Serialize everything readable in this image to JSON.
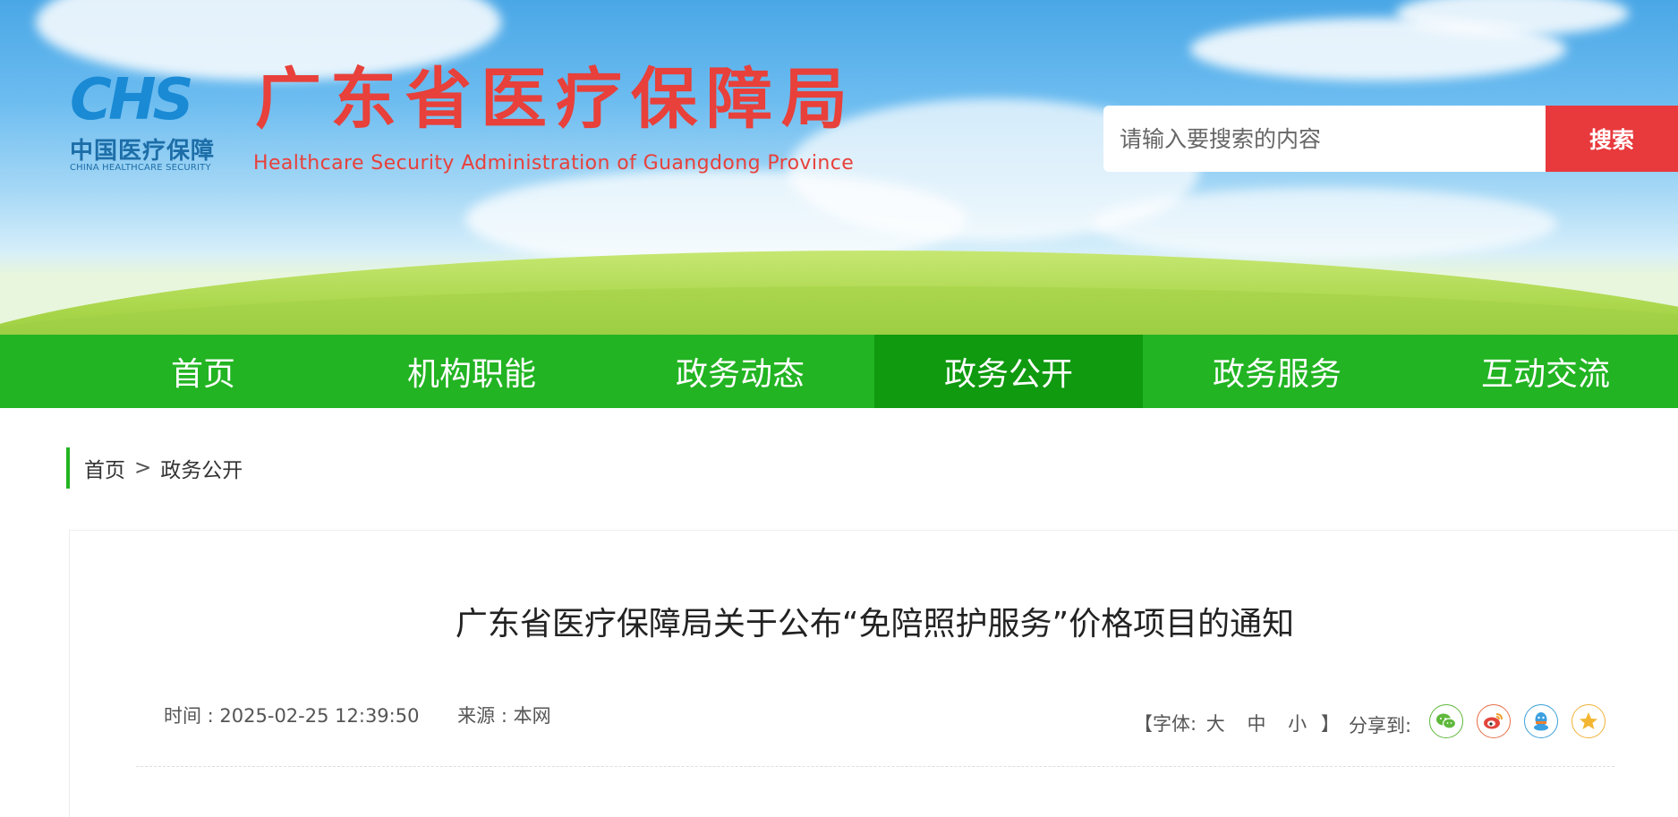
{
  "colors": {
    "nav_green": "#22b422",
    "nav_active": "#0f9a0f",
    "brand_red": "#e8403a",
    "search_red": "#e8393c",
    "logo_blue": "#1a8ad4"
  },
  "header": {
    "logo": {
      "mark": "CHS",
      "cn": "中国医疗保障",
      "en": "CHINA HEALTHCARE SECURITY"
    },
    "title": "广东省医疗保障局",
    "subtitle": "Healthcare Security Administration of Guangdong Province",
    "search": {
      "placeholder": "请输入要搜索的内容",
      "button_label": "搜索"
    }
  },
  "nav": {
    "items": [
      {
        "label": "首页",
        "active": false
      },
      {
        "label": "机构职能",
        "active": false
      },
      {
        "label": "政务动态",
        "active": false
      },
      {
        "label": "政务公开",
        "active": true
      },
      {
        "label": "政务服务",
        "active": false
      },
      {
        "label": "互动交流",
        "active": false
      }
    ]
  },
  "breadcrumb": {
    "home": "首页",
    "separator": ">",
    "current": "政务公开"
  },
  "article": {
    "title": "广东省医疗保障局关于公布“免陪照护服务”价格项目的通知",
    "time": "时间 : 2025-02-25 12:39:50",
    "source": "来源 : 本网",
    "font_size": {
      "open": "【字体:",
      "large": "大",
      "medium": "中",
      "small": "小",
      "close": "】"
    },
    "share_label": "分享到:",
    "share_icons": [
      "wechat-icon",
      "weibo-icon",
      "qq-icon",
      "qzone-icon"
    ]
  }
}
